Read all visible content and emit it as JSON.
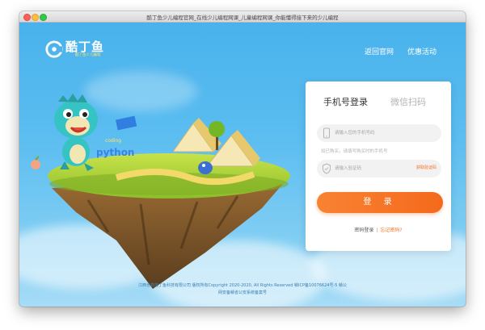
{
  "window": {
    "title": "酷丁鱼少儿编程官网_在线少儿编程网课_儿童编程网课_你能懂得接下来的少儿编程"
  },
  "header": {
    "logo": {
      "name": "酷丁鱼",
      "tagline": "酷丁鱼少儿编程"
    },
    "nav": [
      "返回官网",
      "优惠活动"
    ]
  },
  "illustration": {
    "sign_text": "python",
    "sign_top": "coding"
  },
  "login": {
    "tabs": [
      "手机号登录",
      "微信扫码"
    ],
    "phone_placeholder": "请输入您的手机号码",
    "hint": "如已购买，请填写购买时的手机号",
    "code_placeholder": "请输入验证码",
    "get_code": "获取验证码",
    "submit": "登 录",
    "link_a": "密码登录",
    "link_sep": "|",
    "link_b": "忘记密码?"
  },
  "footer": {
    "line1": "江西省鑫酷丁鱼科技有限公司 版权所有Copyright 2020-2020, All Rights Reserved 赣ICP备10076624号-5 赣公",
    "line2": "网安备赣省公安系统备案号"
  },
  "colors": {
    "sky": "#4fb3ea",
    "accent": "#f5711f",
    "panel": "#ffffff"
  }
}
